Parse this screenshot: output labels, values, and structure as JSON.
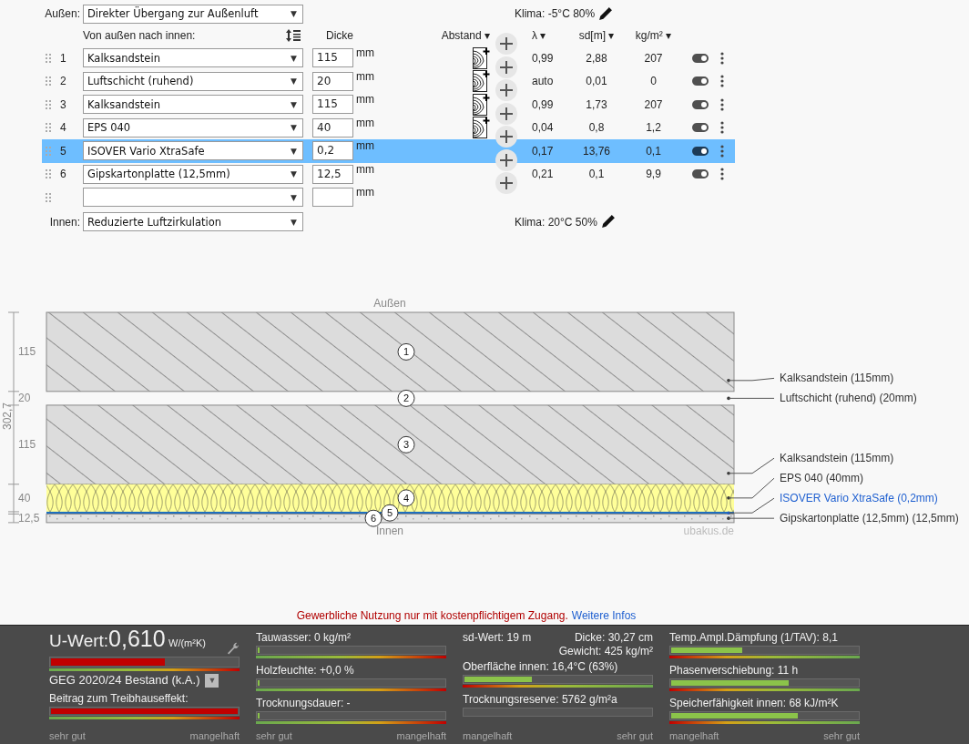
{
  "outside": {
    "label": "Außen:",
    "value": "Direkter Übergang zur Außenluft",
    "caret": "▼"
  },
  "climate_outside": "Klima: -5°C 80%",
  "columns": {
    "order": "Von außen nach innen:",
    "thickness": "Dicke",
    "spacing": "Abstand",
    "spacing_caret": "▾",
    "lambda": "λ",
    "lambda_caret": "▾",
    "sd": "sd[m]",
    "sd_caret": "▾",
    "mass": "kg/m²",
    "mass_caret": "▾"
  },
  "layers": [
    {
      "number": "1",
      "material": "Kalksandstein",
      "caret": "▼",
      "thickness": "115",
      "unit": "mm",
      "spacing_icon": true,
      "lambda": "0,99",
      "sd": "2,88",
      "mass": "207",
      "on": true,
      "selected": false
    },
    {
      "number": "2",
      "material": "Luftschicht (ruhend)",
      "caret": "▼",
      "thickness": "20",
      "unit": "mm",
      "spacing_icon": true,
      "lambda": "auto",
      "sd": "0,01",
      "mass": "0",
      "on": true,
      "selected": false
    },
    {
      "number": "3",
      "material": "Kalksandstein",
      "caret": "▼",
      "thickness": "115",
      "unit": "mm",
      "spacing_icon": true,
      "lambda": "0,99",
      "sd": "1,73",
      "mass": "207",
      "on": true,
      "selected": false
    },
    {
      "number": "4",
      "material": "EPS 040",
      "caret": "▼",
      "thickness": "40",
      "unit": "mm",
      "spacing_icon": true,
      "lambda": "0,04",
      "sd": "0,8",
      "mass": "1,2",
      "on": true,
      "selected": false
    },
    {
      "number": "5",
      "material": "ISOVER Vario XtraSafe",
      "caret": "▼",
      "thickness": "0,2",
      "unit": "mm",
      "spacing_icon": false,
      "lambda": "0,17",
      "sd": "13,76",
      "mass": "0,1",
      "on": true,
      "selected": true
    },
    {
      "number": "6",
      "material": "Gipskartonplatte (12,5mm)",
      "caret": "▼",
      "thickness": "12,5",
      "unit": "mm",
      "spacing_icon": false,
      "lambda": "0,21",
      "sd": "0,1",
      "mass": "9,9",
      "on": true,
      "selected": false
    }
  ],
  "new_row": {
    "caret": "▼",
    "unit": "mm"
  },
  "inside": {
    "label": "Innen:",
    "value": "Reduzierte Luftzirkulation",
    "caret": "▼"
  },
  "climate_inside": "Klima: 20°C 50%",
  "diagram": {
    "top_label": "Außen",
    "bottom_label": "Innen",
    "total": "302,7",
    "credit": "ubakus.de",
    "layers": [
      {
        "kind": "masonry",
        "dim": "115",
        "number": "1",
        "caption": "Kalksandstein (115mm)",
        "highlighted": false
      },
      {
        "kind": "air",
        "dim": "20",
        "number": "2",
        "caption": "Luftschicht (ruhend) (20mm)",
        "highlighted": false
      },
      {
        "kind": "masonry",
        "dim": "115",
        "number": "3",
        "caption": "Kalksandstein (115mm)",
        "highlighted": false
      },
      {
        "kind": "insulation",
        "dim": "40",
        "number": "4",
        "caption": "EPS 040 (40mm)",
        "highlighted": false
      },
      {
        "kind": "membrane",
        "number": "5",
        "caption": "ISOVER Vario XtraSafe (0,2mm)",
        "highlighted": true
      },
      {
        "kind": "board",
        "dim": "12,5",
        "number": "6",
        "caption": "Gipskartonplatte (12,5mm) (12,5mm)",
        "highlighted": false
      }
    ]
  },
  "notice": {
    "text": "Gewerbliche Nutzung nur mit kostenpflichtigem Zugang.",
    "link": "Weitere Infos"
  },
  "results": [
    {
      "reversed_scale": false,
      "scale_left": "sehr gut",
      "scale_right": "mangelhaft",
      "items": [
        {
          "kind": "uvalue",
          "label": "U-Wert:",
          "value": "0,610",
          "unit": "W/(m²K)",
          "level": 0.61,
          "color": "#c00000"
        },
        {
          "kind": "select",
          "value": "GEG 2020/24 Bestand (k.A.)",
          "caret": "▼"
        },
        {
          "kind": "meter",
          "label": "Beitrag zum Treibhauseffekt:",
          "level": 1,
          "color": "#c00000",
          "graded": true
        }
      ]
    },
    {
      "reversed_scale": false,
      "scale_left": "sehr gut",
      "scale_right": "mangelhaft",
      "items": [
        {
          "kind": "meter",
          "label": "Tauwasser: 0 kg/m²",
          "level": 0.01,
          "color": "#8bc34a",
          "graded": true
        },
        {
          "kind": "meter",
          "label": "Holzfeuchte: +0,0 %",
          "level": 0.01,
          "color": "#8bc34a",
          "graded": true
        },
        {
          "kind": "meter",
          "label": "Trocknungsdauer: -",
          "level": 0.01,
          "color": "#8bc34a",
          "graded": true
        }
      ]
    },
    {
      "reversed_scale": true,
      "scale_left": "mangelhaft",
      "scale_right": "sehr gut",
      "items": [
        {
          "kind": "stats",
          "sd": "sd-Wert: 19 m",
          "thickness": "Dicke: 30,27 cm",
          "weight": "Gewicht: 425 kg/m²"
        },
        {
          "kind": "meter",
          "label": "Oberfläche innen: 16,4°C (63%)",
          "level": 0.36,
          "color": "#8bc34a",
          "graded": true
        },
        {
          "kind": "meter",
          "label": "Trocknungsreserve: 5762 g/m²a",
          "graded": false
        }
      ]
    },
    {
      "reversed_scale": true,
      "scale_left": "mangelhaft",
      "scale_right": "sehr gut",
      "items": [
        {
          "kind": "meter",
          "label": "Temp.Ampl.Dämpfung (1/TAV): 8,1",
          "level": 0.38,
          "color": "#8bc34a",
          "graded": true
        },
        {
          "kind": "meter",
          "label": "Phasenverschiebung: 11 h",
          "level": 0.63,
          "color": "#8bc34a",
          "graded": true
        },
        {
          "kind": "meter",
          "label": "Speicherfähigkeit innen: 68 kJ/m²K",
          "level": 0.68,
          "color": "#8bc34a",
          "graded": true
        }
      ]
    }
  ]
}
